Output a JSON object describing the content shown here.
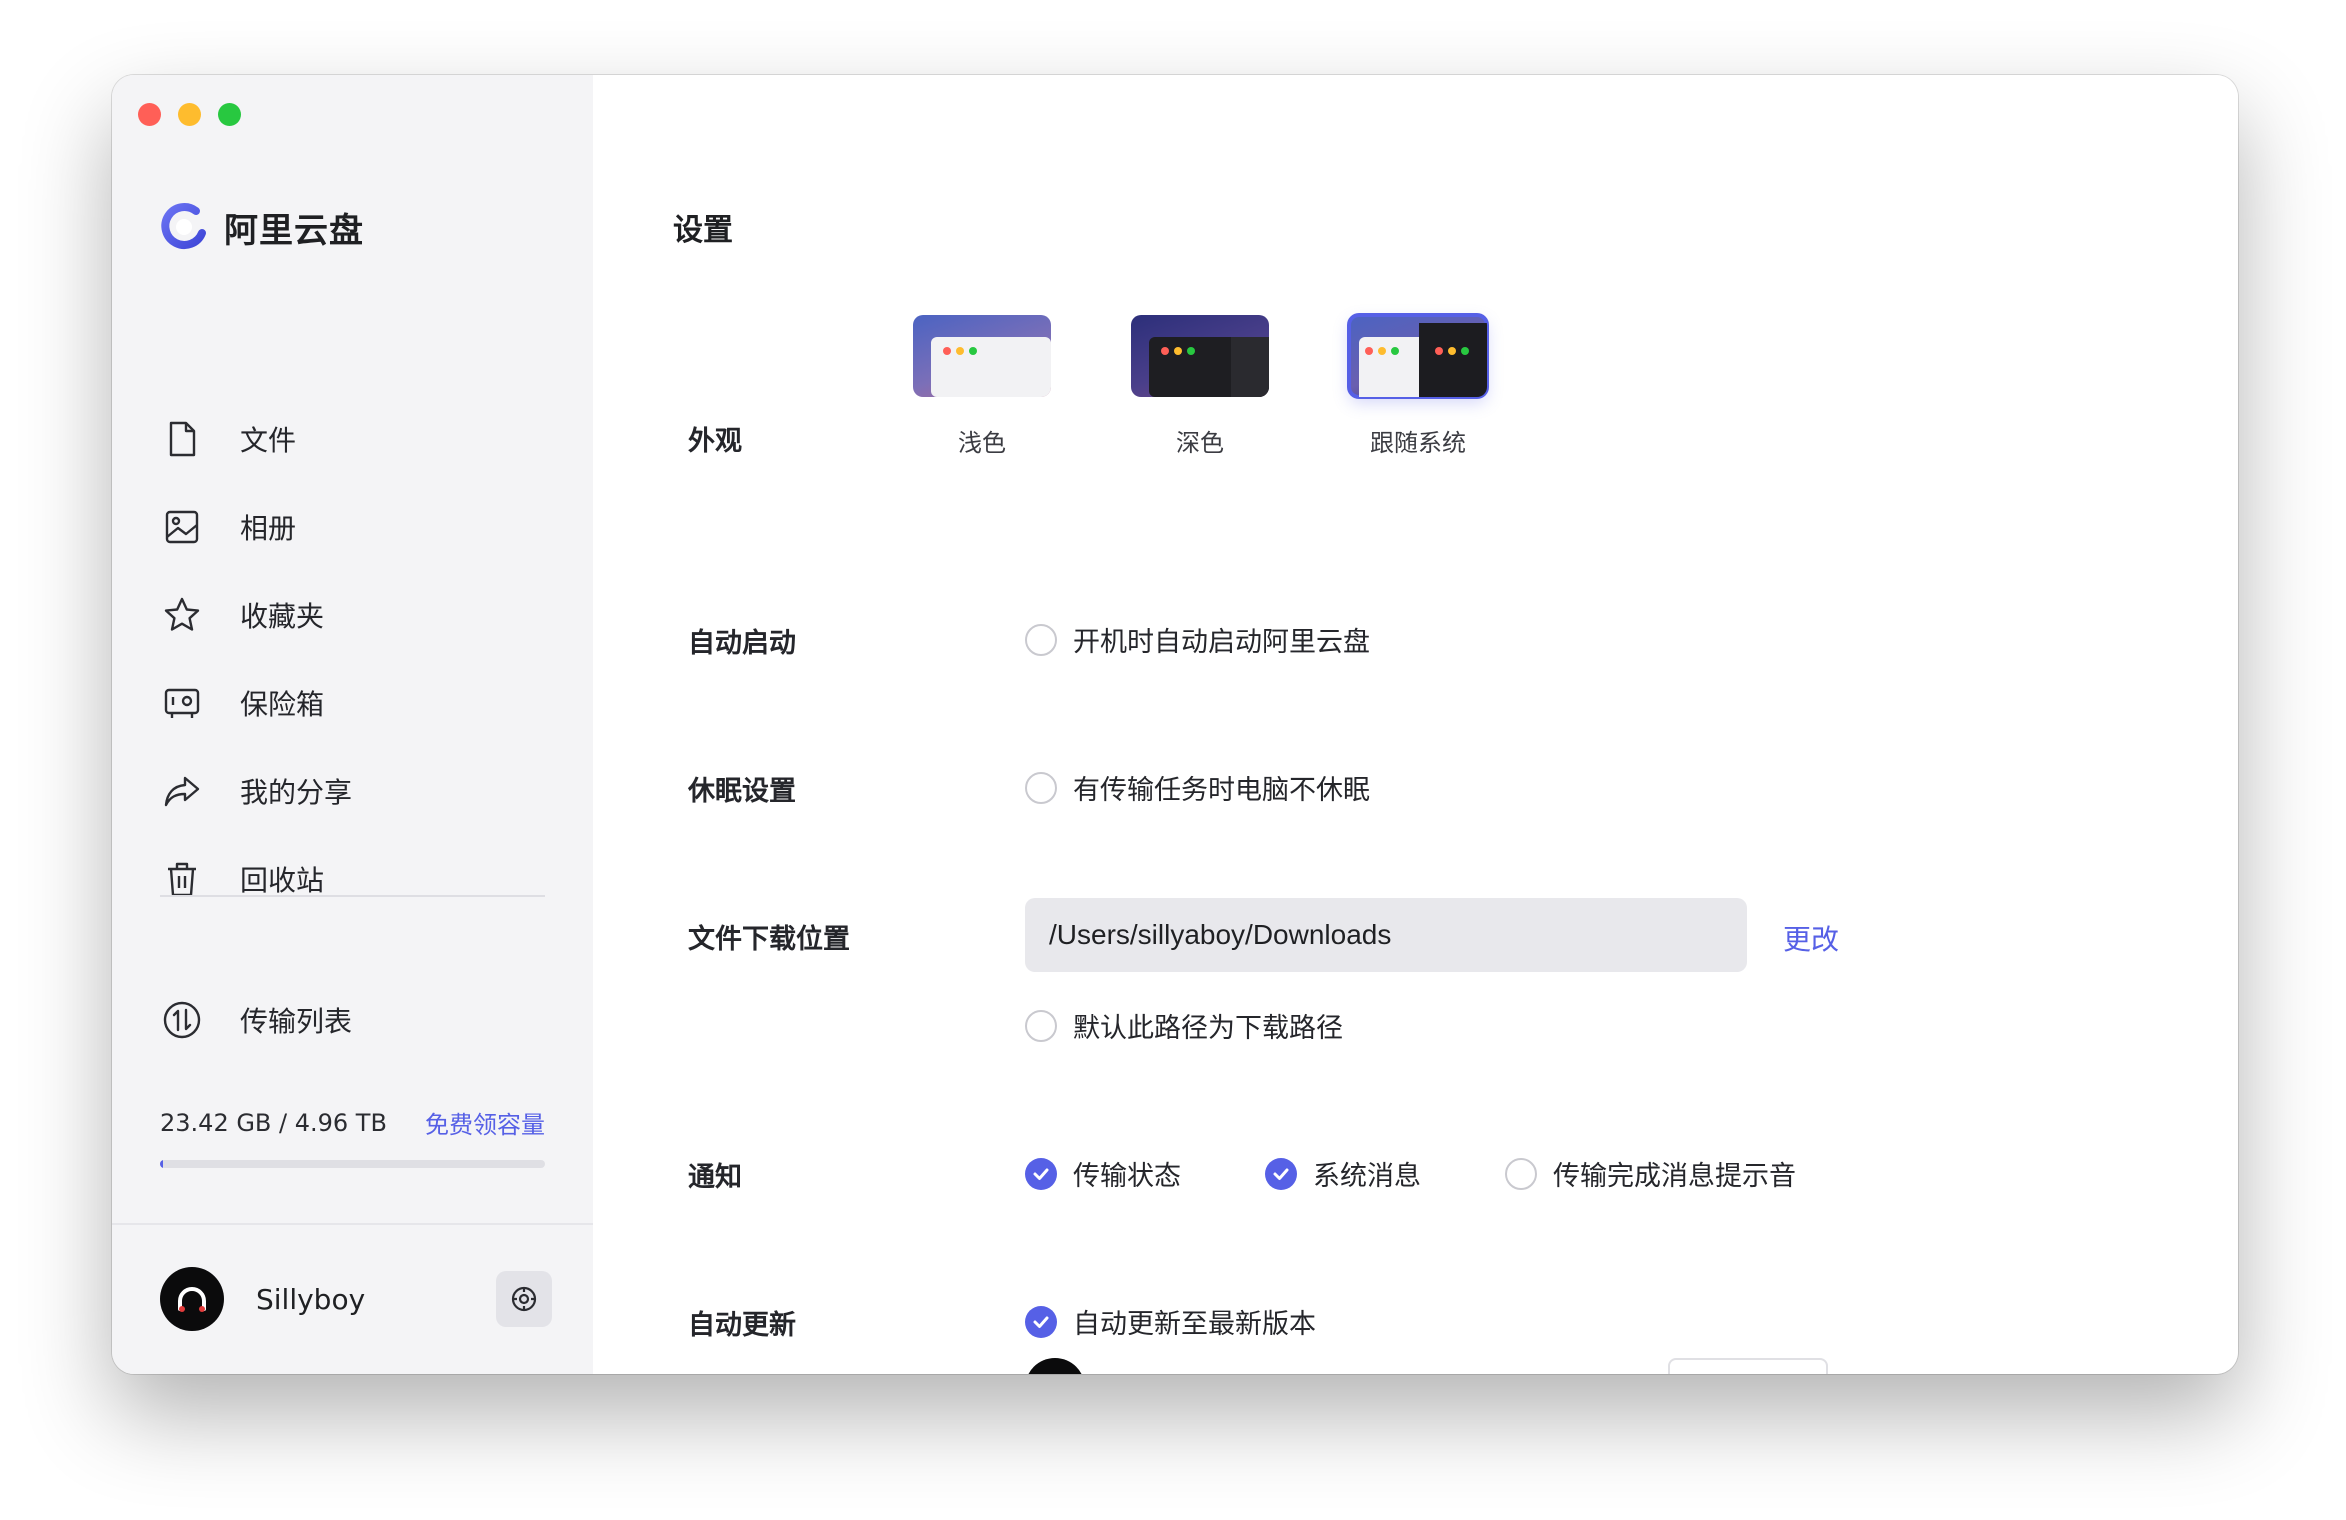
{
  "app": {
    "name": "阿里云盘"
  },
  "sidebar": {
    "items": [
      {
        "label": "文件",
        "icon": "file-icon"
      },
      {
        "label": "相册",
        "icon": "photo-album-icon"
      },
      {
        "label": "收藏夹",
        "icon": "star-icon"
      },
      {
        "label": "保险箱",
        "icon": "safe-icon"
      },
      {
        "label": "我的分享",
        "icon": "share-icon"
      },
      {
        "label": "回收站",
        "icon": "trash-icon"
      }
    ],
    "transfer": {
      "label": "传输列表",
      "icon": "transfer-icon"
    },
    "storage": {
      "usage_text": "23.42 GB / 4.96 TB",
      "link_label": "免费领容量",
      "used_fraction": 0.0046
    },
    "user": {
      "name": "Sillyboy"
    }
  },
  "settings": {
    "title": "设置",
    "appearance": {
      "label": "外观",
      "options": [
        {
          "label": "浅色",
          "selected": false
        },
        {
          "label": "深色",
          "selected": false
        },
        {
          "label": "跟随系统",
          "selected": true
        }
      ]
    },
    "autostart": {
      "label": "自动启动",
      "option": "开机时自动启动阿里云盘",
      "checked": false
    },
    "sleep": {
      "label": "休眠设置",
      "option": "有传输任务时电脑不休眠",
      "checked": false
    },
    "download": {
      "label": "文件下载位置",
      "path": "/Users/sillyaboy/Downloads",
      "change_label": "更改",
      "default_option": "默认此路径为下载路径",
      "default_checked": false
    },
    "notification": {
      "label": "通知",
      "options": [
        {
          "label": "传输状态",
          "checked": true
        },
        {
          "label": "系统消息",
          "checked": true
        },
        {
          "label": "传输完成消息提示音",
          "checked": false
        }
      ]
    },
    "autoupdate": {
      "label": "自动更新",
      "option": "自动更新至最新版本",
      "checked": true
    }
  },
  "colors": {
    "accent": "#5660e6",
    "sidebar_bg": "#f4f4f6",
    "traffic_red": "#ff5f57",
    "traffic_yellow": "#febc2e",
    "traffic_green": "#28c840"
  }
}
